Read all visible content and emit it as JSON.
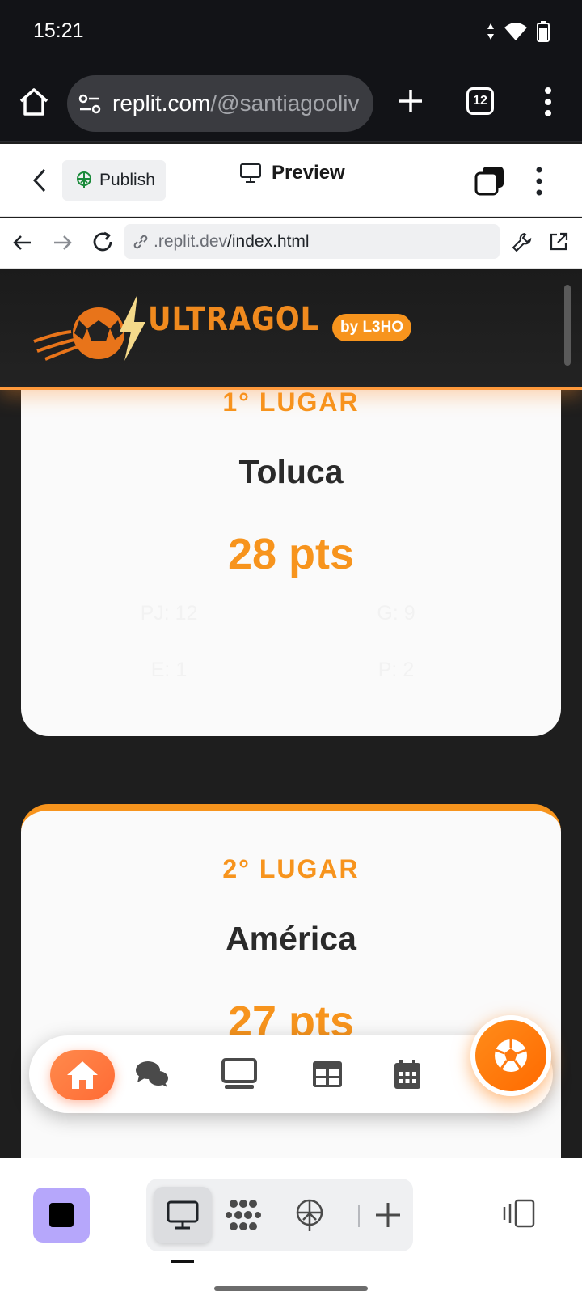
{
  "status": {
    "time": "15:21"
  },
  "chrome": {
    "url_host": "replit.com",
    "url_path": "/@santiagooliv",
    "tab_count": "12"
  },
  "replit": {
    "publish_label": "Publish",
    "preview_label": "Preview",
    "address_dim": ".replit.dev",
    "address_path": "/index.html"
  },
  "app": {
    "logo_text": "ULTRAGOL",
    "badge": "by L3HO",
    "accent_color": "#f7941d",
    "cards": [
      {
        "place": "1° LUGAR",
        "team": "Toluca",
        "pts": "28 pts",
        "stats": [
          "PJ: 12",
          "G: 9",
          "E: 1",
          "P: 2"
        ]
      },
      {
        "place": "2° LUGAR",
        "team": "América",
        "pts": "27 pts"
      }
    ],
    "nav_items": [
      "home-icon",
      "chat-icon",
      "tv-icon",
      "table-icon",
      "calendar-icon"
    ],
    "fab_icon": "soccer-ball-icon"
  },
  "bottom": {
    "items": [
      "square-icon",
      "desktop-icon",
      "dots-icon",
      "publish-icon",
      "plus-icon",
      "devices-icon"
    ]
  }
}
